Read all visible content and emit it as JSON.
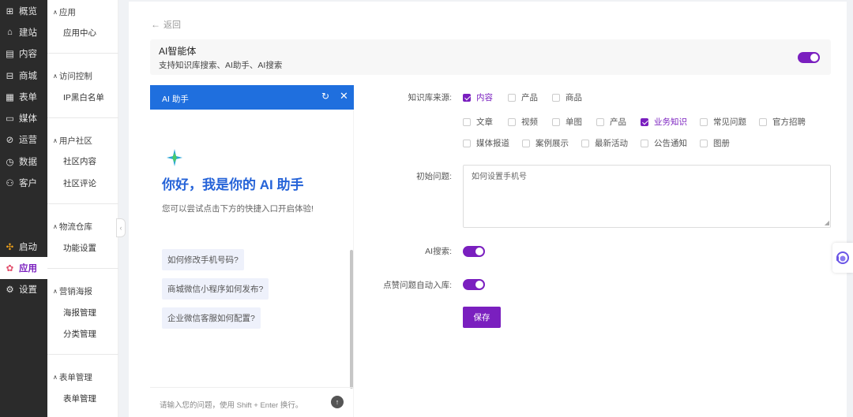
{
  "nav": {
    "top_items": [
      {
        "label": "概览",
        "icon": "overview-icon"
      },
      {
        "label": "建站",
        "icon": "home-icon"
      },
      {
        "label": "内容",
        "icon": "content-icon"
      },
      {
        "label": "商城",
        "icon": "cart-icon"
      },
      {
        "label": "表单",
        "icon": "form-icon"
      },
      {
        "label": "媒体",
        "icon": "media-icon"
      },
      {
        "label": "运营",
        "icon": "tag-icon"
      },
      {
        "label": "数据",
        "icon": "data-icon"
      },
      {
        "label": "客户",
        "icon": "user-icon"
      }
    ],
    "bottom_items": [
      {
        "label": "启动",
        "icon": "launch-icon"
      },
      {
        "label": "应用",
        "icon": "apps-icon",
        "active": true
      },
      {
        "label": "设置",
        "icon": "gear-icon"
      }
    ],
    "accent_color": "#7a1fbf"
  },
  "subnav": {
    "groups": [
      {
        "title": "应用",
        "items": [
          "应用中心"
        ]
      },
      {
        "title": "访问控制",
        "items": [
          "IP黑白名单"
        ]
      },
      {
        "title": "用户社区",
        "items": [
          "社区内容",
          "社区评论"
        ]
      },
      {
        "title": "物流仓库",
        "items": [
          "功能设置"
        ]
      },
      {
        "title": "营销海报",
        "items": [
          "海报管理",
          "分类管理"
        ]
      },
      {
        "title": "表单管理",
        "items": [
          "表单管理"
        ]
      }
    ]
  },
  "main": {
    "back_label": "返回",
    "banner": {
      "title": "AI智能体",
      "subtitle": "支持知识库搜索、AI助手、AI搜索",
      "enabled": true
    },
    "chat": {
      "header_title": "AI 助手",
      "greeting": "你好，我是你的 AI 助手",
      "greeting_sub": "您可以尝试点击下方的快捷入口开启体验!",
      "quick_questions": [
        "如何修改手机号码?",
        "商城微信小程序如何发布?",
        "企业微信客服如何配置?"
      ],
      "input_placeholder": "请输入您的问题，使用 Shift + Enter 换行。",
      "header_color": "#1f6fde"
    },
    "form": {
      "kb_label": "知识库来源:",
      "kb_sources": [
        {
          "label": "内容",
          "checked": true
        },
        {
          "label": "产品",
          "checked": false
        },
        {
          "label": "商品",
          "checked": false
        },
        {
          "label": "文章",
          "checked": false
        },
        {
          "label": "视频",
          "checked": false
        },
        {
          "label": "单图",
          "checked": false
        },
        {
          "label": "产品",
          "checked": false
        },
        {
          "label": "业务知识",
          "checked": true
        },
        {
          "label": "常见问题",
          "checked": false
        },
        {
          "label": "官方招聘",
          "checked": false
        },
        {
          "label": "媒体报道",
          "checked": false
        },
        {
          "label": "案例展示",
          "checked": false
        },
        {
          "label": "最新活动",
          "checked": false
        },
        {
          "label": "公告通知",
          "checked": false
        },
        {
          "label": "图册",
          "checked": false
        }
      ],
      "initial_label": "初始问题:",
      "initial_value": "如何设置手机号",
      "ai_search_label": "AI搜索:",
      "ai_search_enabled": true,
      "auto_store_label": "点赞问题自动入库:",
      "auto_store_enabled": true,
      "save_label": "保存"
    }
  }
}
